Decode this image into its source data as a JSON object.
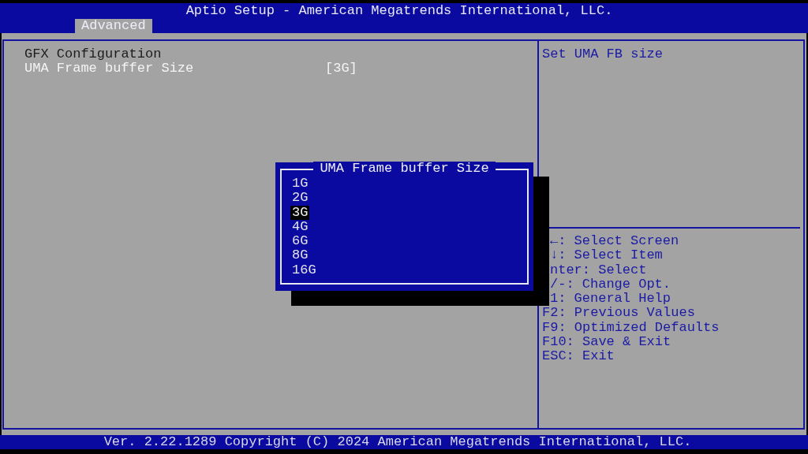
{
  "header": {
    "title": "Aptio Setup - American Megatrends International, LLC.",
    "tabs": [
      {
        "label": "Advanced",
        "selected": true
      }
    ]
  },
  "main": {
    "items": [
      {
        "kind": "heading",
        "label": "GFX Configuration",
        "selected": false
      },
      {
        "kind": "setting",
        "label": "UMA Frame buffer Size",
        "value": "[3G]",
        "selected": true
      }
    ]
  },
  "help": {
    "description": "Set UMA FB size",
    "keys": [
      {
        "text": "←: Select Screen",
        "partly_covered": true
      },
      {
        "text": "↓: Select Item",
        "partly_covered": true
      },
      {
        "text": "nter: Select",
        "partly_covered": true
      },
      {
        "text": "/-: Change Opt.",
        "partly_covered": true
      },
      {
        "text": "1: General Help",
        "partly_covered": true
      },
      {
        "text": "F2: Previous Values"
      },
      {
        "text": "F9: Optimized Defaults"
      },
      {
        "text": "F10: Save & Exit"
      },
      {
        "text": "ESC: Exit"
      }
    ]
  },
  "dialog": {
    "title": "UMA Frame buffer Size",
    "options": [
      {
        "label": "1G",
        "selected": false
      },
      {
        "label": "2G",
        "selected": false
      },
      {
        "label": "3G",
        "selected": true
      },
      {
        "label": "4G",
        "selected": false
      },
      {
        "label": "6G",
        "selected": false
      },
      {
        "label": "8G",
        "selected": false
      },
      {
        "label": "16G",
        "selected": false
      }
    ]
  },
  "footer": {
    "text": "Ver. 2.22.1289 Copyright (C) 2024 American Megatrends International, LLC."
  }
}
